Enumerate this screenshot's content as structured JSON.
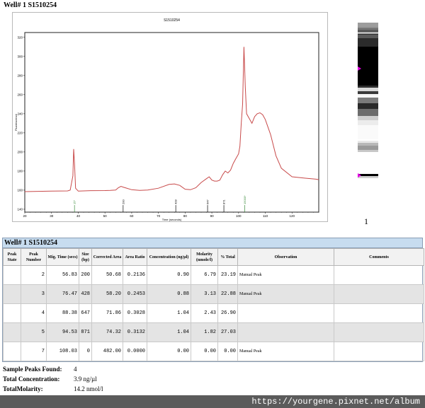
{
  "well_title": "Well# 1  S1510254",
  "chart_data": {
    "type": "line",
    "title": "S1510254",
    "xlabel": "Time (seconds)",
    "ylabel": "Fluorescence",
    "xlim": [
      20,
      130
    ],
    "ylim": [
      137,
      325
    ],
    "x_ticks": [
      20,
      30,
      40,
      50,
      60,
      70,
      80,
      90,
      100,
      110,
      120
    ],
    "y_ticks": [
      140,
      160,
      180,
      200,
      220,
      240,
      260,
      280,
      300,
      320
    ],
    "series": [
      {
        "x": [
          20,
          30,
          36,
          37,
          38,
          38.3,
          38.6,
          39,
          40,
          45,
          50,
          52,
          54,
          55,
          56,
          57,
          58,
          60,
          63,
          66,
          70,
          74,
          76,
          78,
          80,
          82,
          84,
          86,
          88,
          89,
          90,
          91,
          92,
          93,
          94,
          95,
          96,
          97,
          98,
          99,
          100,
          100.5,
          101,
          101.5,
          102,
          102.5,
          103,
          104,
          105,
          106,
          107,
          108,
          109,
          110,
          112,
          114,
          116,
          120,
          125,
          129,
          130
        ],
        "y": [
          158.5,
          159,
          159.2,
          160,
          175,
          203,
          188,
          162,
          159,
          159.5,
          159.6,
          159.8,
          160.2,
          162.5,
          164,
          163,
          162.2,
          160.5,
          159.8,
          160.2,
          162,
          166,
          166.5,
          165,
          161,
          160.5,
          162.5,
          168,
          172,
          174,
          170.5,
          169.5,
          169.5,
          170.5,
          176,
          180,
          178,
          181,
          188,
          193,
          198,
          206,
          230,
          250,
          310,
          268,
          240,
          235,
          230,
          237,
          240,
          241,
          239,
          234,
          218,
          196,
          183,
          174,
          172.5,
          171.5,
          171
        ]
      }
    ],
    "peak_markers": [
      {
        "x": 38.6,
        "label": "15*",
        "color": "#3a8a3a"
      },
      {
        "x": 56.8,
        "label": "200",
        "color": "#000000"
      },
      {
        "x": 76.5,
        "label": "428",
        "color": "#000000"
      },
      {
        "x": 88.4,
        "label": "647",
        "color": "#000000"
      },
      {
        "x": 94.5,
        "label": "871",
        "color": "#000000"
      },
      {
        "x": 102.3,
        "label": "15000*",
        "color": "#3a8a3a"
      }
    ],
    "line_color": "#c84a4a"
  },
  "gel": {
    "lane_label": "1",
    "marker_color": "#e000e0"
  },
  "table": {
    "header": "Well# 1  S1510254",
    "columns": [
      "Peak State",
      "Peak Number",
      "Mig. Time (secs)",
      "Size (bp)",
      "Corrected Area",
      "Area Ratio",
      "Concentration (ng/µl)",
      "Molarity (nmole/l)",
      "% Total",
      "Observation",
      "Comments"
    ],
    "rows": [
      {
        "state": "",
        "number": "2",
        "mig": "56.83",
        "size": "200",
        "area": "50.68",
        "ratio": "0.2136",
        "conc": "0.90",
        "molarity": "6.79",
        "total": "23.19",
        "obs": "Manual Peak",
        "comments": ""
      },
      {
        "state": "",
        "number": "3",
        "mig": "76.47",
        "size": "428",
        "area": "58.20",
        "ratio": "0.2453",
        "conc": "0.88",
        "molarity": "3.13",
        "total": "22.88",
        "obs": "Manual Peak",
        "comments": ""
      },
      {
        "state": "",
        "number": "4",
        "mig": "88.38",
        "size": "647",
        "area": "71.86",
        "ratio": "0.3028",
        "conc": "1.04",
        "molarity": "2.43",
        "total": "26.90",
        "obs": "",
        "comments": ""
      },
      {
        "state": "",
        "number": "5",
        "mig": "94.53",
        "size": "871",
        "area": "74.32",
        "ratio": "0.3132",
        "conc": "1.04",
        "molarity": "1.82",
        "total": "27.03",
        "obs": "",
        "comments": ""
      },
      {
        "state": "",
        "number": "7",
        "mig": "108.03",
        "size": "0",
        "area": "482.00",
        "ratio": "0.0000",
        "conc": "0.00",
        "molarity": "0.00",
        "total": "0.00",
        "obs": "Manual Peak",
        "comments": ""
      }
    ]
  },
  "summary": {
    "peaks_label": "Sample Peaks Found:",
    "peaks_value": "4",
    "conc_label": "Total Concentration:",
    "conc_value": "3.9 ng/µl",
    "molarity_label": "TotalMolarity:",
    "molarity_value": "14.2 nmol/l"
  },
  "watermark": "https://yourgene.pixnet.net/album"
}
